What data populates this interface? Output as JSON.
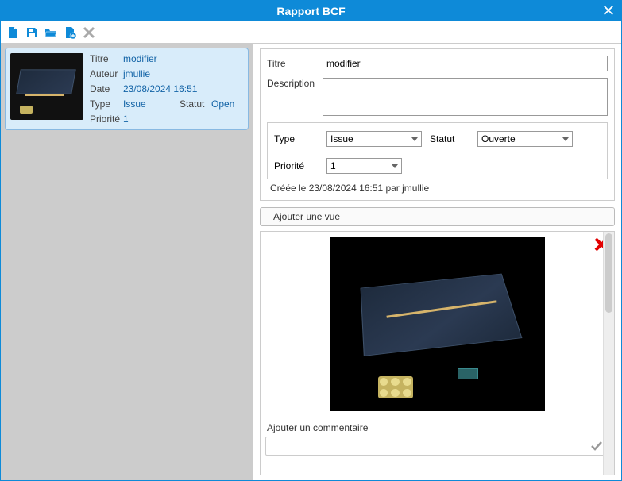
{
  "window": {
    "title": "Rapport BCF"
  },
  "card": {
    "labels": {
      "title": "Titre",
      "author": "Auteur",
      "date": "Date",
      "type": "Type",
      "status": "Statut",
      "priority": "Priorité"
    },
    "values": {
      "title": "modifier",
      "author": "jmullie",
      "date": "23/08/2024 16:51",
      "type": "Issue",
      "status": "Open",
      "priority": "1"
    }
  },
  "form": {
    "labels": {
      "title": "Titre",
      "description": "Description",
      "type": "Type",
      "status": "Statut",
      "priority": "Priorité"
    },
    "values": {
      "title": "modifier",
      "type": "Issue",
      "status": "Ouverte",
      "priority": "1"
    },
    "created": "Créée le 23/08/2024 16:51 par jmullie"
  },
  "buttons": {
    "add_view": "Ajouter une vue"
  },
  "comment": {
    "label": "Ajouter un commentaire"
  }
}
